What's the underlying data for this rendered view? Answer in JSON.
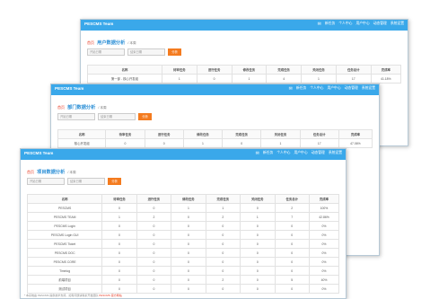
{
  "app_title": "PESCMS Team",
  "nav": {
    "mail_icon": "mail-icon",
    "items": [
      "新任务",
      "个人中心",
      "用户中心",
      "动态管理",
      "系统设置"
    ]
  },
  "home_label": "首页",
  "filter": {
    "start_placeholder": "开始日期",
    "end_placeholder": "结束日期",
    "button_label": "分析"
  },
  "headers": [
    "名称",
    "待审任务",
    "进行任务",
    "修改任务",
    "完成任务",
    "关闭任务",
    "任务总计",
    "完成率"
  ],
  "window1": {
    "title": "用户数据分析",
    "subtitle": "/ 本周",
    "rows": [
      [
        "第一部 - 核心开发组",
        "1",
        "0",
        "1",
        "4",
        "1",
        "17",
        "41.18%"
      ]
    ]
  },
  "window2": {
    "title": "部门数据分析",
    "subtitle": "/ 本周",
    "rows": [
      [
        "核心开发组",
        "0",
        "0",
        "1",
        "0",
        "1",
        "17",
        "47.06%"
      ]
    ]
  },
  "window3": {
    "title": "项目数据分析",
    "subtitle": "/ 本周",
    "rows": [
      [
        "PESCMS",
        "0",
        "0",
        "1",
        "1",
        "0",
        "2",
        "100%"
      ],
      [
        "PESCMS TEAM",
        "1",
        "2",
        "0",
        "2",
        "1",
        "7",
        "42.86%"
      ],
      [
        "PESCMS Login",
        "0",
        "0",
        "0",
        "0",
        "0",
        "0",
        "0%"
      ],
      [
        "PESCMS Login GUI",
        "0",
        "0",
        "0",
        "0",
        "0",
        "0",
        "0%"
      ],
      [
        "PESCMS Ticket",
        "0",
        "0",
        "0",
        "0",
        "0",
        "0",
        "0%"
      ],
      [
        "PESCMS DOC",
        "0",
        "0",
        "0",
        "0",
        "0",
        "0",
        "0%"
      ],
      [
        "PESCMS CORE",
        "0",
        "0",
        "0",
        "0",
        "0",
        "0",
        "0%"
      ],
      [
        "Timelog",
        "0",
        "0",
        "0",
        "0",
        "0",
        "0",
        "0%"
      ],
      [
        "前端项目",
        "0",
        "0",
        "0",
        "2",
        "0",
        "5",
        "40%"
      ],
      [
        "测试项目",
        "0",
        "0",
        "0",
        "0",
        "0",
        "0",
        "0%"
      ]
    ],
    "footer_text": "* 本系统由 PESCMS 提供技术支持，如有问题请联系开发团队",
    "footer_link": "PESCMS 官方网站"
  }
}
